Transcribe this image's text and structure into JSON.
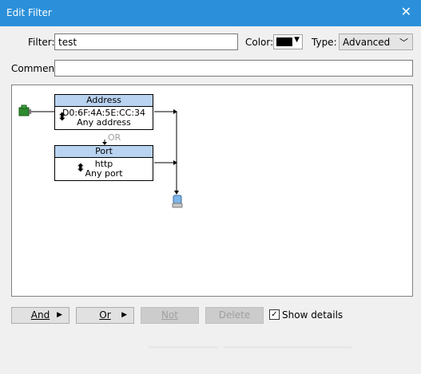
{
  "window": {
    "title": "Edit Filter",
    "close_glyph": "✕"
  },
  "form": {
    "filter_label": "Filter:",
    "filter_value": "test",
    "color_label": "Color:",
    "color_value": "#000000",
    "type_label": "Type:",
    "type_value": "Advanced",
    "comment_label": "Comment:",
    "comment_value": ""
  },
  "diagram": {
    "blocks": [
      {
        "title": "Address",
        "lines": [
          "D0:6F:4A:5E:CC:34",
          "Any address"
        ]
      },
      {
        "title": "Port",
        "lines": [
          "http",
          "Any port"
        ]
      }
    ],
    "connector_label": "OR",
    "source_icon": "network-adapter-icon",
    "target_icon": "computer-icon"
  },
  "buttons": {
    "and": "And",
    "or": "Or",
    "not": "Not",
    "delete": "Delete",
    "show_details": "Show details",
    "show_details_checked": true
  },
  "colors": {
    "titlebar": "#2b90d9",
    "block_header": "#b9d3f1"
  }
}
